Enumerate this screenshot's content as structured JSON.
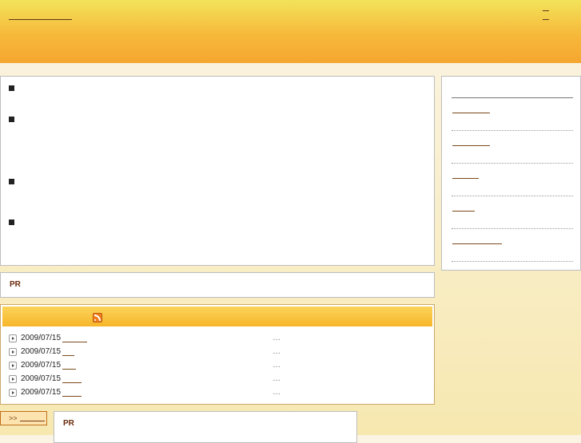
{
  "header": {
    "site_title": "",
    "top_links": [
      "",
      ""
    ]
  },
  "main": {
    "bullets": [
      "",
      "",
      "",
      ""
    ]
  },
  "sidebar": {
    "items": [
      "",
      "",
      "",
      "",
      ""
    ]
  },
  "pr": {
    "label": "PR"
  },
  "news": {
    "feed_icon": "rss-icon",
    "entries": [
      {
        "date": "2009/07/15",
        "title": "",
        "ellipsis": "…"
      },
      {
        "date": "2009/07/15",
        "title": "",
        "ellipsis": "…"
      },
      {
        "date": "2009/07/15",
        "title": "",
        "ellipsis": "…"
      },
      {
        "date": "2009/07/15",
        "title": "",
        "ellipsis": "…"
      },
      {
        "date": "2009/07/15",
        "title": "",
        "ellipsis": "…"
      }
    ]
  },
  "footer": {
    "more_prefix": ">>",
    "pr_label": "PR"
  },
  "colors": {
    "header_top": "#f2e35a",
    "header_bottom": "#f5a630",
    "link": "#7a4a1a",
    "pr_label": "#6a2a0a"
  }
}
